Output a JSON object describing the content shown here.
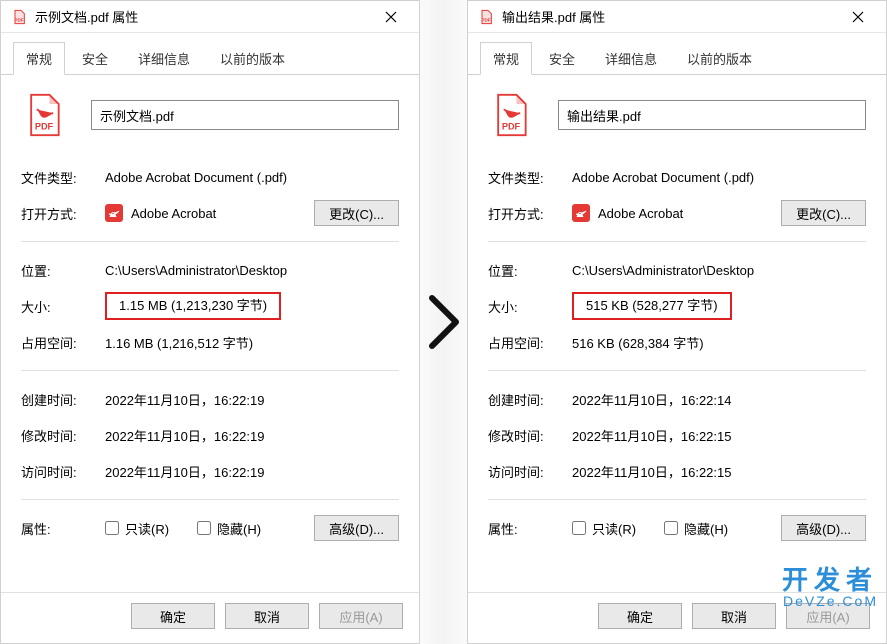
{
  "left": {
    "title": "示例文档.pdf 属性",
    "filename": "示例文档.pdf",
    "filetype": "Adobe Acrobat Document (.pdf)",
    "openwith": "Adobe Acrobat",
    "change_btn": "更改(C)...",
    "location": "C:\\Users\\Administrator\\Desktop",
    "size": "1.15 MB (1,213,230 字节)",
    "size_on_disk": "1.16 MB (1,216,512 字节)",
    "created": "2022年11月10日，16:22:19",
    "modified": "2022年11月10日，16:22:19",
    "accessed": "2022年11月10日，16:22:19",
    "advanced_btn": "高级(D)..."
  },
  "right": {
    "title": "输出结果.pdf 属性",
    "filename": "输出结果.pdf",
    "filetype": "Adobe Acrobat Document (.pdf)",
    "openwith": "Adobe Acrobat",
    "change_btn": "更改(C)...",
    "location": "C:\\Users\\Administrator\\Desktop",
    "size": "515 KB (528,277 字节)",
    "size_on_disk": "516 KB (628,384 字节)",
    "created": "2022年11月10日，16:22:14",
    "modified": "2022年11月10日，16:22:15",
    "accessed": "2022年11月10日，16:22:15",
    "advanced_btn": "高级(D)..."
  },
  "labels": {
    "filetype": "文件类型:",
    "openwith": "打开方式:",
    "location": "位置:",
    "size": "大小:",
    "size_on_disk": "占用空间:",
    "created": "创建时间:",
    "modified": "修改时间:",
    "accessed": "访问时间:",
    "attributes": "属性:",
    "readonly": "只读(R)",
    "hidden": "隐藏(H)"
  },
  "tabs": [
    "常规",
    "安全",
    "详细信息",
    "以前的版本"
  ],
  "footer": {
    "ok": "确定",
    "cancel": "取消",
    "apply": "应用(A)"
  },
  "watermark": {
    "top": "开发者",
    "bottom": "DeVZe.CoM"
  }
}
